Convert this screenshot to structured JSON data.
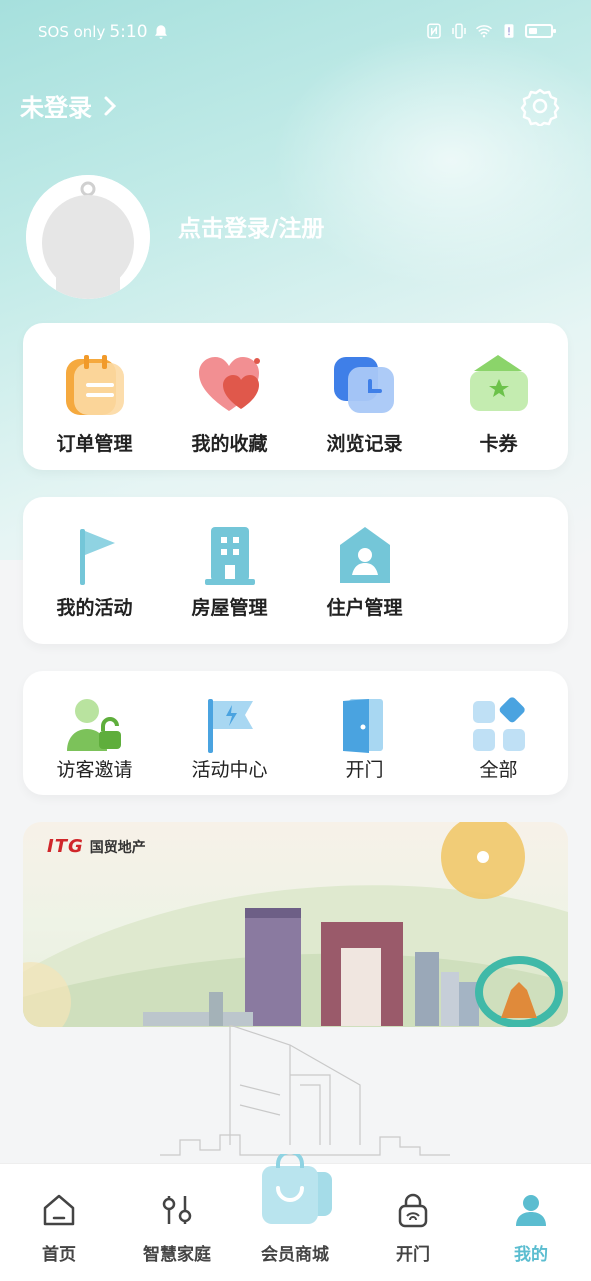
{
  "status_bar": {
    "carrier": "SOS only",
    "time": "5:10"
  },
  "header": {
    "title": "未登录",
    "settings_icon": "gear-icon"
  },
  "profile": {
    "login_prompt": "点击登录/注册"
  },
  "quick_menu": [
    {
      "label": "订单管理",
      "icon": "order-icon"
    },
    {
      "label": "我的收藏",
      "icon": "heart-icon"
    },
    {
      "label": "浏览记录",
      "icon": "history-icon"
    },
    {
      "label": "卡券",
      "icon": "ticket-icon"
    }
  ],
  "property_menu": [
    {
      "label": "我的活动",
      "icon": "flag-icon"
    },
    {
      "label": "房屋管理",
      "icon": "building-icon"
    },
    {
      "label": "住户管理",
      "icon": "resident-icon"
    }
  ],
  "services": [
    {
      "label": "访客邀请",
      "icon": "visitor-icon"
    },
    {
      "label": "活动中心",
      "icon": "event-flag-icon"
    },
    {
      "label": "开门",
      "icon": "door-icon"
    },
    {
      "label": "全部",
      "icon": "grid-icon"
    }
  ],
  "banner": {
    "brand_latin": "ITG",
    "brand_cn": "国贸地产"
  },
  "tabbar": [
    {
      "label": "首页",
      "icon": "home-icon",
      "active": false
    },
    {
      "label": "智慧家庭",
      "icon": "sliders-icon",
      "active": false
    },
    {
      "label": "会员商城",
      "icon": "shopping-bag-icon",
      "active": false
    },
    {
      "label": "开门",
      "icon": "lock-icon",
      "active": false
    },
    {
      "label": "我的",
      "icon": "person-icon",
      "active": true
    }
  ],
  "colors": {
    "accent": "#5bbdd0",
    "header_gradient_start": "#a6e0dd",
    "brand_red": "#d0262a"
  }
}
